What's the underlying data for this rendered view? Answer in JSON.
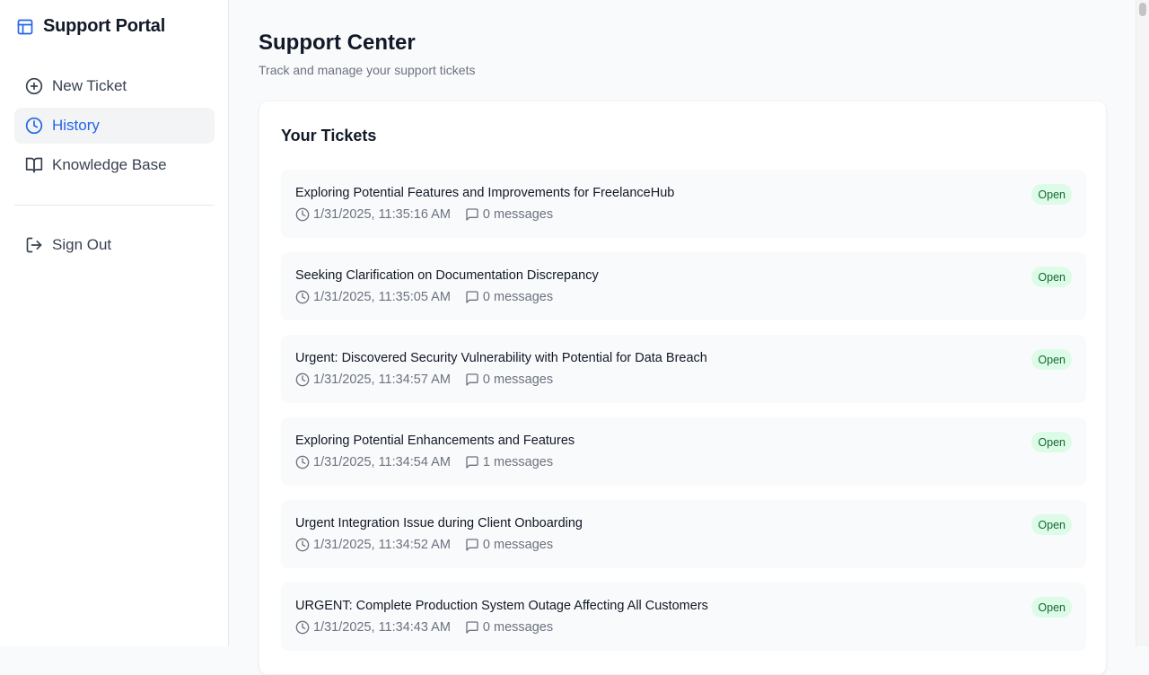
{
  "brand": {
    "title": "Support Portal",
    "accent": "#2563eb"
  },
  "sidebar": {
    "items": [
      {
        "label": "New Ticket",
        "icon": "plus-circle-icon",
        "active": false
      },
      {
        "label": "History",
        "icon": "clock-icon",
        "active": true
      },
      {
        "label": "Knowledge Base",
        "icon": "book-open-icon",
        "active": false
      }
    ],
    "sign_out": {
      "label": "Sign Out",
      "icon": "log-out-icon"
    }
  },
  "main": {
    "title": "Support Center",
    "subtitle": "Track and manage your support tickets",
    "card_title": "Your Tickets",
    "status_colors": {
      "open_bg": "#dcfce7",
      "open_text": "#166534"
    },
    "tickets": [
      {
        "title": "Exploring Potential Features and Improvements for FreelanceHub",
        "timestamp": "1/31/2025, 11:35:16 AM",
        "messages": "0 messages",
        "status": "Open"
      },
      {
        "title": "Seeking Clarification on Documentation Discrepancy",
        "timestamp": "1/31/2025, 11:35:05 AM",
        "messages": "0 messages",
        "status": "Open"
      },
      {
        "title": "Urgent: Discovered Security Vulnerability with Potential for Data Breach",
        "timestamp": "1/31/2025, 11:34:57 AM",
        "messages": "0 messages",
        "status": "Open"
      },
      {
        "title": "Exploring Potential Enhancements and Features",
        "timestamp": "1/31/2025, 11:34:54 AM",
        "messages": "1 messages",
        "status": "Open"
      },
      {
        "title": "Urgent Integration Issue during Client Onboarding",
        "timestamp": "1/31/2025, 11:34:52 AM",
        "messages": "0 messages",
        "status": "Open"
      },
      {
        "title": "URGENT: Complete Production System Outage Affecting All Customers",
        "timestamp": "1/31/2025, 11:34:43 AM",
        "messages": "0 messages",
        "status": "Open"
      }
    ]
  }
}
